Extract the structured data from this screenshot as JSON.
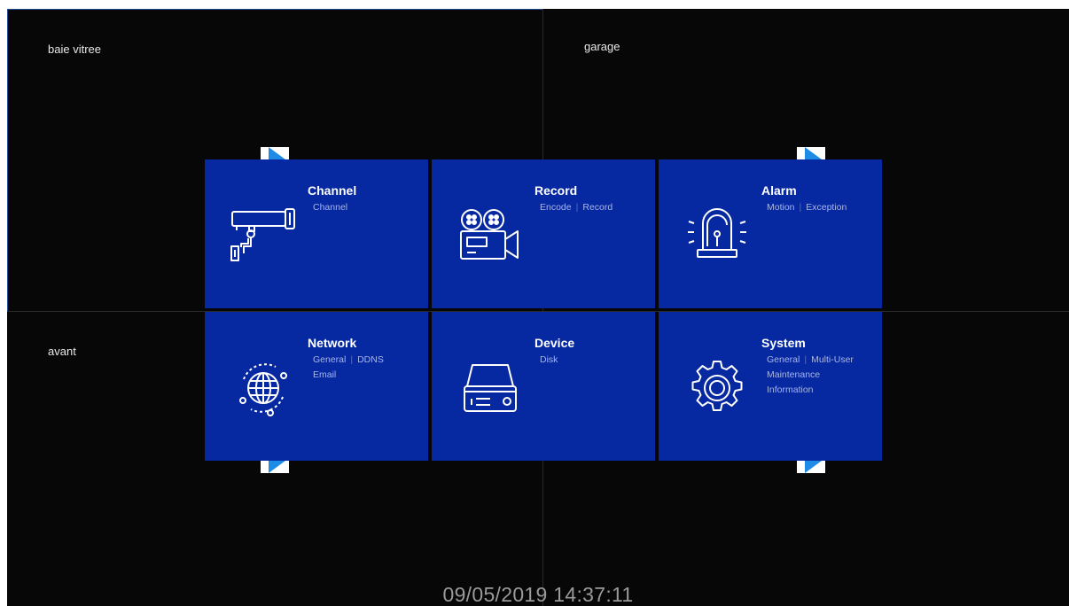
{
  "cameras": [
    {
      "label": "baie vitree"
    },
    {
      "label": "garage"
    },
    {
      "label": "avant"
    },
    {
      "label": ""
    }
  ],
  "menu": {
    "tiles": [
      {
        "title": "Channel",
        "items": [
          "Channel"
        ],
        "icon": "camera-icon"
      },
      {
        "title": "Record",
        "items": [
          "Encode",
          "Record"
        ],
        "icon": "video-camera-icon"
      },
      {
        "title": "Alarm",
        "items": [
          "Motion",
          "Exception"
        ],
        "icon": "siren-icon"
      },
      {
        "title": "Network",
        "items": [
          "General",
          "DDNS",
          "Email"
        ],
        "icon": "globe-icon"
      },
      {
        "title": "Device",
        "items": [
          "Disk"
        ],
        "icon": "hard-disk-icon"
      },
      {
        "title": "System",
        "items": [
          "General",
          "Multi-User",
          "Maintenance",
          "Information"
        ],
        "icon": "gear-icon"
      }
    ]
  },
  "status": {
    "datetime": "09/05/2019 14:37:11"
  },
  "colors": {
    "tile": "#0628a0",
    "background": "#070707",
    "selected_border": "#1f4e9c",
    "marker": "#1e8be6"
  }
}
